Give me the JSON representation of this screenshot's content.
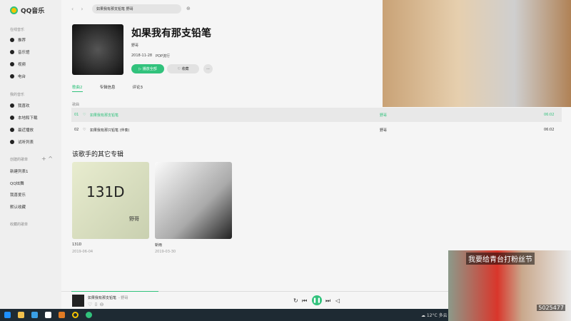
{
  "app": {
    "name": "QQ音乐"
  },
  "sidebar": {
    "online_section": "在线音乐",
    "online": [
      {
        "label": "推荐"
      },
      {
        "label": "音乐馆"
      },
      {
        "label": "视频"
      },
      {
        "label": "电台"
      }
    ],
    "mine_section": "我的音乐",
    "mine": [
      {
        "label": "我喜欢"
      },
      {
        "label": "本地和下载"
      },
      {
        "label": "最近播放"
      },
      {
        "label": "试听列表"
      }
    ],
    "created_section": "创建的歌单",
    "created": [
      {
        "label": "新建列表1"
      },
      {
        "label": "QQ炫舞"
      },
      {
        "label": "我喜爱乐"
      },
      {
        "label": "默认收藏"
      }
    ],
    "collected_section": "收藏的歌单"
  },
  "search": {
    "value": "如果我有那支铅笔 野哥"
  },
  "album": {
    "title": "如果我有那支铅笔",
    "artist": "野哥",
    "date": "2018-11-28",
    "genre": "POP流行",
    "play_all": "播放全部",
    "favorite": "收藏",
    "more": "···"
  },
  "tabs": [
    {
      "label": "歌曲2"
    },
    {
      "label": "专辑信息"
    },
    {
      "label": "评论3"
    }
  ],
  "songs_header": "歌曲",
  "songs": [
    {
      "num": "01",
      "title": "如果我有那支铅笔",
      "artist": "野哥",
      "duration": "06:02"
    },
    {
      "num": "02",
      "title": "如果我有那只铅笔 (伴奏)",
      "artist": "野哥",
      "duration": "06:02"
    }
  ],
  "other_albums": {
    "heading": "该歌手的其它专辑",
    "items": [
      {
        "name": "131D",
        "date": "2019-06-04",
        "cover_text": "131D",
        "cover_sub": "野哥"
      },
      {
        "name": "斩雨",
        "date": "2019-03-30"
      }
    ]
  },
  "player": {
    "title": "如果我有那支铅笔",
    "artist": "- 野哥",
    "progress": 0.2
  },
  "taskbar": {
    "weather": "12°C",
    "weather_text": "多云"
  },
  "overlay": {
    "caption": "我要给青台打粉丝节",
    "room": "5025477"
  },
  "colors": {
    "accent": "#31c27c"
  }
}
